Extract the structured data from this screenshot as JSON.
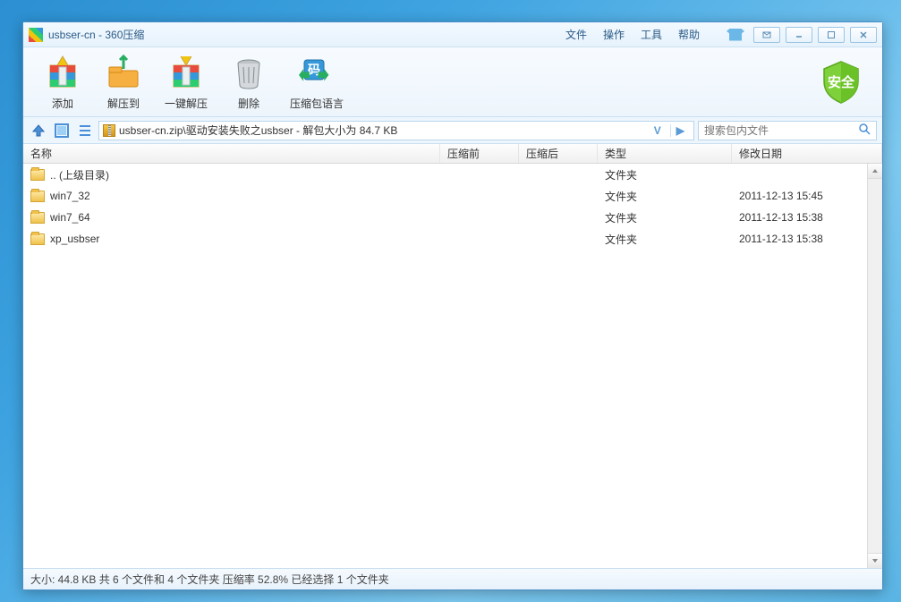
{
  "title": "usbser-cn - 360压缩",
  "menus": [
    "文件",
    "操作",
    "工具",
    "帮助"
  ],
  "toolbar": {
    "add": "添加",
    "extract_to": "解压到",
    "one_click": "一键解压",
    "delete": "删除",
    "lang": "压缩包语言",
    "security": "安全"
  },
  "path": "usbser-cn.zip\\驱动安装失败之usbser - 解包大小为 84.7 KB",
  "search_placeholder": "搜索包内文件",
  "columns": {
    "name": "名称",
    "before": "压缩前",
    "after": "压缩后",
    "type": "类型",
    "date": "修改日期"
  },
  "rows": [
    {
      "name": ".. (上级目录)",
      "type": "文件夹",
      "date": ""
    },
    {
      "name": "win7_32",
      "type": "文件夹",
      "date": "2011-12-13 15:45"
    },
    {
      "name": "win7_64",
      "type": "文件夹",
      "date": "2011-12-13 15:38"
    },
    {
      "name": "xp_usbser",
      "type": "文件夹",
      "date": "2011-12-13 15:38"
    }
  ],
  "status": "大小: 44.8 KB 共 6 个文件和 4 个文件夹 压缩率 52.8% 已经选择 1 个文件夹"
}
